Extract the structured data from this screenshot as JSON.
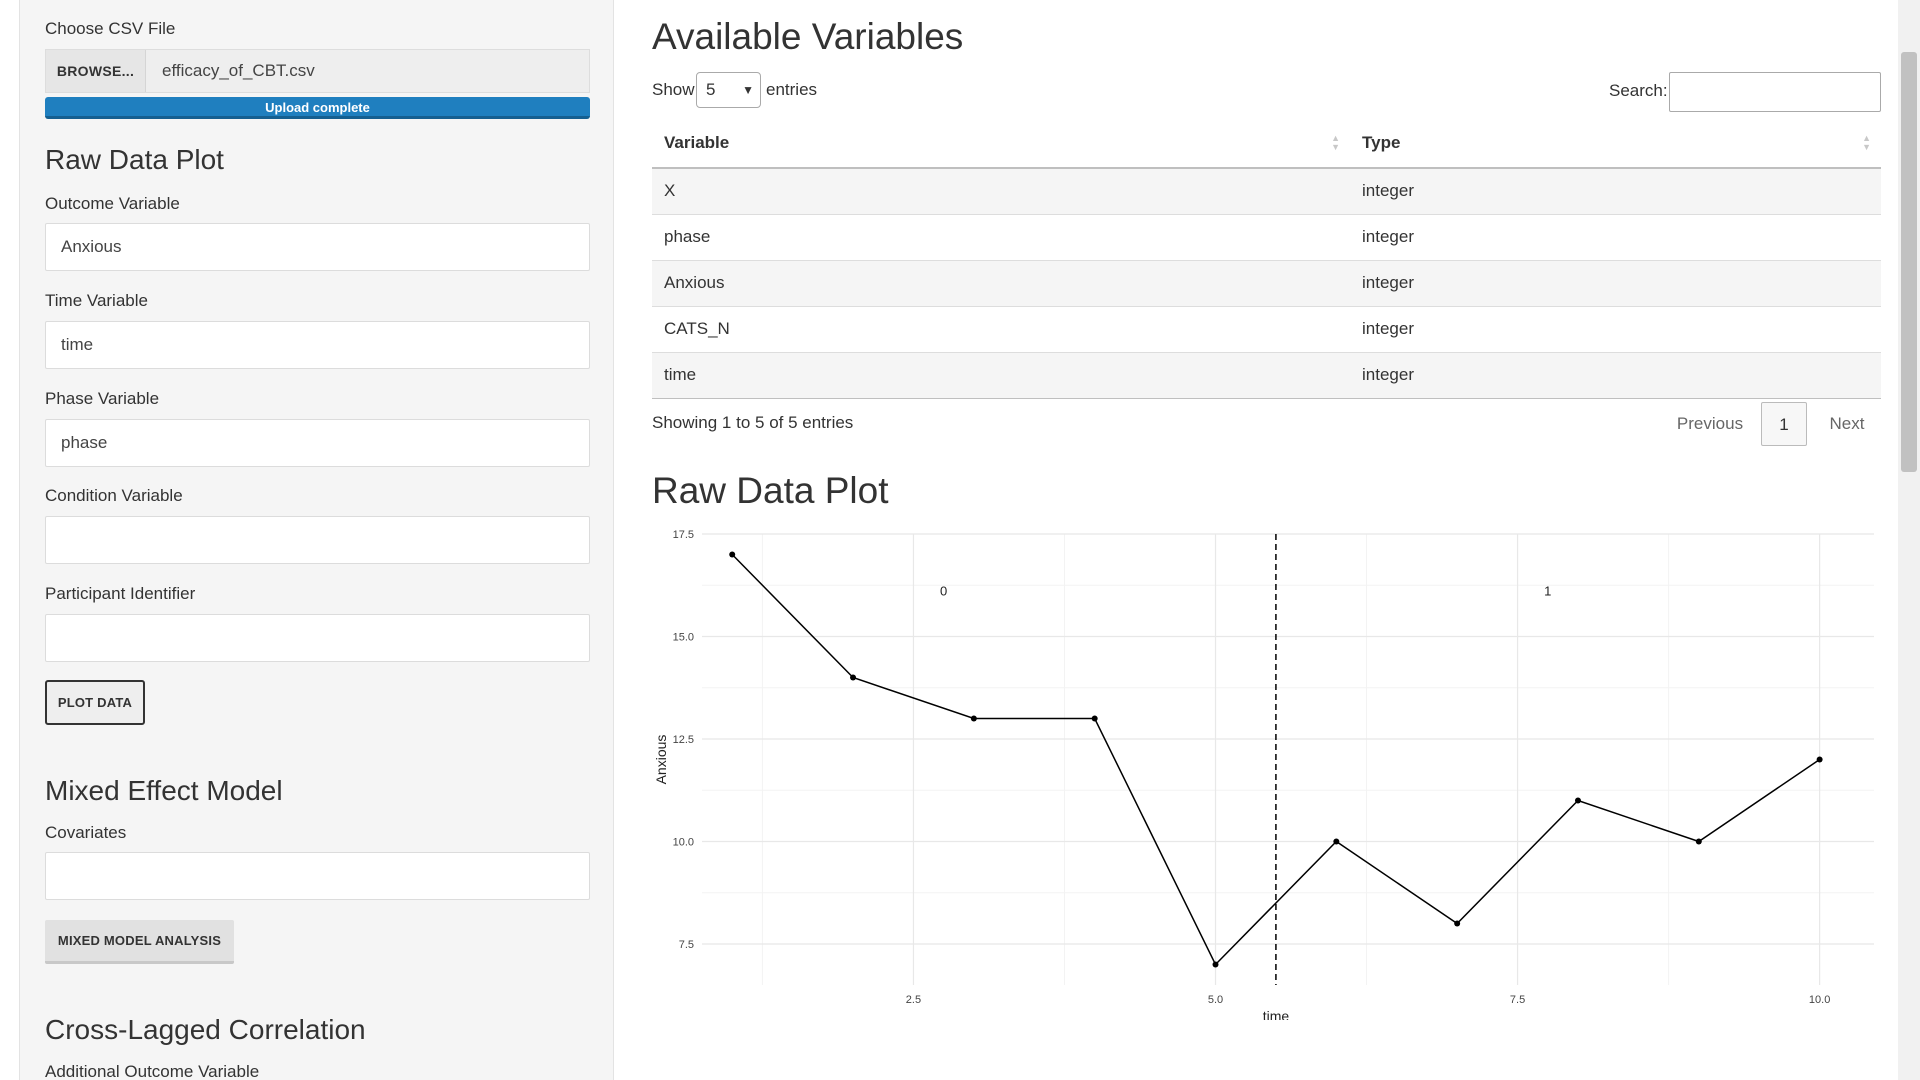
{
  "sidebar": {
    "file_label": "Choose CSV File",
    "browse_label": "BROWSE...",
    "file_name": "efficacy_of_CBT.csv",
    "upload_status": "Upload complete",
    "raw_plot_heading": "Raw Data Plot",
    "outcome_label": "Outcome Variable",
    "outcome_value": "Anxious",
    "time_label": "Time Variable",
    "time_value": "time",
    "phase_label": "Phase Variable",
    "phase_value": "phase",
    "condition_label": "Condition Variable",
    "condition_value": "",
    "participant_label": "Participant Identifier",
    "participant_value": "",
    "plot_button": "PLOT DATA",
    "mixed_heading": "Mixed Effect Model",
    "covariates_label": "Covariates",
    "covariates_value": "",
    "mixed_button": "MIXED MODEL ANALYSIS",
    "crosslag_heading": "Cross-Lagged Correlation",
    "additional_outcome_label": "Additional Outcome Variable"
  },
  "main": {
    "vars_heading": "Available Variables",
    "show_label": "Show",
    "entries_value": "5",
    "entries_label": "entries",
    "search_label": "Search:",
    "columns": [
      "Variable",
      "Type"
    ],
    "rows": [
      [
        "X",
        "integer"
      ],
      [
        "phase",
        "integer"
      ],
      [
        "Anxious",
        "integer"
      ],
      [
        "CATS_N",
        "integer"
      ],
      [
        "time",
        "integer"
      ]
    ],
    "table_info": "Showing 1 to 5 of 5 entries",
    "pager_previous": "Previous",
    "pager_current": "1",
    "pager_next": "Next",
    "plot_heading": "Raw Data Plot"
  },
  "chart_data": {
    "type": "line",
    "xlabel": "time",
    "ylabel": "Anxious",
    "x": [
      1,
      2,
      3,
      4,
      5,
      6,
      7,
      8,
      9,
      10
    ],
    "y": [
      17,
      14,
      13,
      13,
      7,
      10,
      8,
      11,
      10,
      12
    ],
    "xlim": [
      0.75,
      10.45
    ],
    "ylim": [
      6.5,
      17.5
    ],
    "x_ticks": [
      "2.5",
      "5.0",
      "7.5",
      "10.0"
    ],
    "y_ticks": [
      "7.5",
      "10.0",
      "12.5",
      "15.0",
      "17.5"
    ],
    "phase_change_x": 5.5,
    "phase_labels": [
      {
        "text": "0",
        "x": 2.75,
        "y": 16.0
      },
      {
        "text": "1",
        "x": 7.75,
        "y": 16.0
      }
    ],
    "grid": true,
    "line_color": "#000000"
  }
}
